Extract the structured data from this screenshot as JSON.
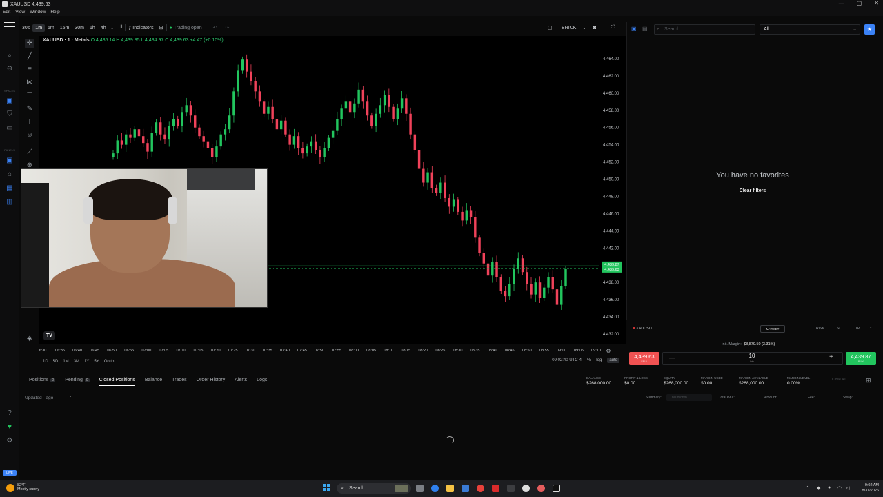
{
  "window": {
    "title": "XAUUSD 4,439.63",
    "menu": [
      "Edit",
      "View",
      "Window",
      "Help"
    ],
    "controls": [
      "—",
      "▢",
      "✕"
    ]
  },
  "toolbar": {
    "timeframes": [
      "30s",
      "1m",
      "5m",
      "15m",
      "30m",
      "1h",
      "4h"
    ],
    "active_timeframe": "1m",
    "indicators_label": "Indicators",
    "trading_status": "Trading open",
    "chart_style": "BRICK"
  },
  "symbol": {
    "name": "XAUUSD · 1 · Metals",
    "open": "O 4,435.14",
    "high": "H 4,439.85",
    "low": "L 4,434.97",
    "close": "C 4,439.63",
    "change": "+4.47 (+0.10%)"
  },
  "rail": {
    "labels": [
      "SPACES",
      "PANELS"
    ]
  },
  "chart_data": {
    "type": "candlestick",
    "ylim": [
      4432,
      4466
    ],
    "y_ticks": [
      "4,464.00",
      "4,462.00",
      "4,460.00",
      "4,458.00",
      "4,456.00",
      "4,454.00",
      "4,452.00",
      "4,450.00",
      "4,448.00",
      "4,446.00",
      "4,444.00",
      "4,442.00",
      "4,440.00",
      "4,438.00",
      "4,436.00",
      "4,434.00",
      "4,432.00"
    ],
    "x_ticks": [
      "6:30",
      "06:35",
      "06:40",
      "06:45",
      "06:50",
      "06:55",
      "07:00",
      "07:05",
      "07:10",
      "07:15",
      "07:20",
      "07:25",
      "07:30",
      "07:35",
      "07:40",
      "07:45",
      "07:50",
      "07:55",
      "08:00",
      "08:05",
      "08:10",
      "08:15",
      "08:20",
      "08:25",
      "08:30",
      "08:35",
      "08:40",
      "08:45",
      "08:50",
      "08:55",
      "09:00",
      "09:05",
      "09:10"
    ],
    "last_price_labels": [
      "4,439.87",
      "4,439.63"
    ],
    "path": [
      4453.0,
      4454.5,
      4454.0,
      4455.2,
      4454.8,
      4455.8,
      4455.0,
      4454.2,
      4453.2,
      4455.4,
      4456.6,
      4455.2,
      4454.6,
      4456.2,
      4457.0,
      4456.2,
      4457.8,
      4458.6,
      4457.4,
      4456.0,
      4455.0,
      4454.4,
      4453.6,
      4452.6,
      4453.8,
      4455.2,
      4455.8,
      4457.4,
      4460.2,
      4462.6,
      4463.9,
      4462.5,
      4461.4,
      4460.2,
      4459.0,
      4457.6,
      4458.4,
      4457.0,
      4455.8,
      4456.8,
      4455.2,
      4454.0,
      4455.0,
      4453.6,
      4453.0,
      4453.8,
      4454.4,
      4453.4,
      4452.6,
      4453.6,
      4454.8,
      4455.6,
      4457.0,
      4458.2,
      4459.0,
      4457.8,
      4458.8,
      4460.4,
      4459.0,
      4457.4,
      4456.2,
      4457.6,
      4458.6,
      4459.8,
      4458.4,
      4457.0,
      4458.2,
      4459.4,
      4457.6,
      4455.2,
      4453.4,
      4451.2,
      4449.6,
      4450.8,
      4449.0,
      4448.4,
      4449.6,
      4447.8,
      4446.8,
      4447.6,
      4446.2,
      4445.2,
      4446.4,
      4445.6,
      4443.2,
      4441.4,
      4440.2,
      4438.8,
      4440.4,
      4438.6,
      4437.0,
      4436.4,
      4437.8,
      4439.6,
      4440.8,
      4439.2,
      4437.8,
      4436.6,
      4438.0,
      4436.2,
      4437.4,
      4438.6,
      4437.2,
      4435.4,
      4437.6,
      4439.6
    ],
    "current_price": 4439.63,
    "clock": "09:02:40 UTC-4"
  },
  "range_bar": {
    "periods": [
      "1D",
      "5D",
      "1M",
      "3M",
      "1Y",
      "5Y"
    ],
    "goto": "Go to",
    "percent": "%",
    "log": "log",
    "auto": "auto"
  },
  "watchlist": {
    "search_placeholder": "Search...",
    "filter": "All",
    "empty_message": "You have no favorites",
    "clear_filters": "Clear filters"
  },
  "ticket": {
    "symbol": "XAUUSD",
    "order_type": "MARKET",
    "mini": [
      "RISK",
      "SL",
      "TP"
    ],
    "margin_label": "Init. Margin:",
    "margin_value": "-$8,879.50 (3.31%)",
    "sell_price": "4,439.63",
    "sell_label": "SELL",
    "buy_price": "4,439.87",
    "buy_label": "BUY",
    "quantity": "10",
    "quantity_unit": "lots"
  },
  "bottom": {
    "tabs": [
      {
        "label": "Positions",
        "badge": "0"
      },
      {
        "label": "Pending",
        "badge": "0"
      },
      {
        "label": "Closed Positions",
        "badge": ""
      },
      {
        "label": "Balance",
        "badge": ""
      },
      {
        "label": "Trades",
        "badge": ""
      },
      {
        "label": "Order History",
        "badge": ""
      },
      {
        "label": "Alerts",
        "badge": ""
      },
      {
        "label": "Logs",
        "badge": ""
      }
    ],
    "active_tab": "Closed Positions",
    "account": [
      {
        "label": "BALANCE",
        "value": "$268,000.00"
      },
      {
        "label": "PROFIT & LOSS",
        "value": "$0.00"
      },
      {
        "label": "EQUITY",
        "value": "$268,000.00"
      },
      {
        "label": "MARGIN USED",
        "value": "$0.00"
      },
      {
        "label": "MARGIN AVAILABLE",
        "value": "$268,000.00"
      },
      {
        "label": "MARGIN LEVEL",
        "value": "0.00%"
      }
    ],
    "close_all": "Close All",
    "updated": "Updated - ago",
    "summary_label": "Summary:",
    "summary_select": "This month",
    "total_pnl": "Total P&L:",
    "amount": "Amount:",
    "fee": "Fee:",
    "swap": "Swap:"
  },
  "taskbar": {
    "temp": "82°F",
    "weather": "Mostly sunny",
    "search": "Search",
    "time": "9:02 AM",
    "date": "8/31/2026"
  },
  "live_badge": "LIVE",
  "colors": {
    "up": "#22c55e",
    "down": "#f0425a",
    "accent": "#3b82f6"
  }
}
